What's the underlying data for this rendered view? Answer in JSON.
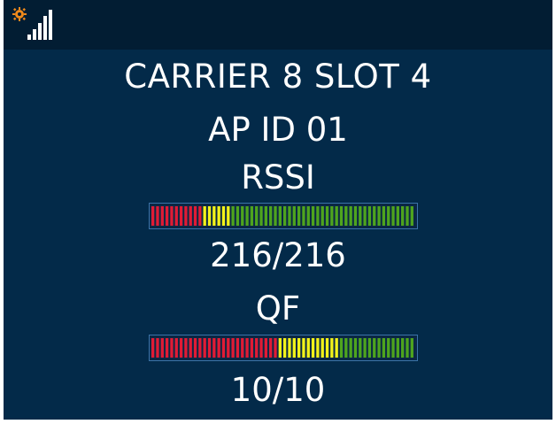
{
  "status_bar": {
    "icons": [
      "gear-icon",
      "signal-strength-icon"
    ],
    "colors": {
      "gear": "#f08a1c",
      "signal": "#ffffff"
    }
  },
  "screen": {
    "title": "CARRIER 8 SLOT 4",
    "ap_id": "AP ID 01",
    "rssi": {
      "label": "RSSI",
      "value_text": "216/216",
      "meter": {
        "level": 1.0,
        "segments": 56,
        "red_segments": 11,
        "yellow_segments": 6
      }
    },
    "qf": {
      "label": "QF",
      "value_text": "10/10",
      "meter": {
        "level": 1.0,
        "segments": 56,
        "red_segments": 27,
        "yellow_segments": 13
      }
    }
  },
  "colors": {
    "background": "#032a49",
    "status_bar": "#021d33",
    "text": "#ffffff",
    "meter_red": "#e01b35",
    "meter_yellow": "#f2f21a",
    "meter_green": "#4ea41e",
    "meter_border": "#3b73a8"
  }
}
